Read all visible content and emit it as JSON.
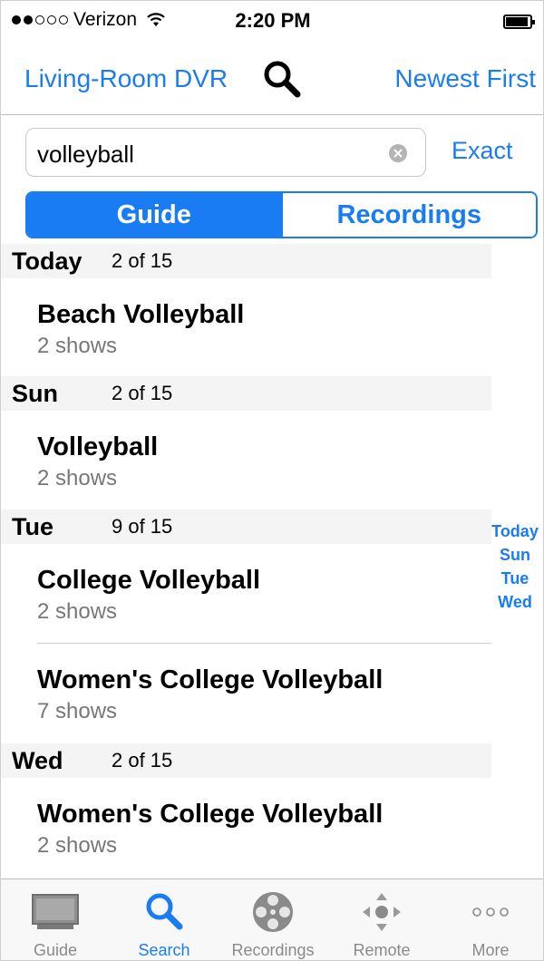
{
  "status_bar": {
    "carrier": "Verizon",
    "time": "2:20 PM",
    "signal_strength": 2,
    "signal_max": 5
  },
  "nav": {
    "title": "Living-Room DVR",
    "sort_label": "Newest First"
  },
  "search": {
    "value": "volleyball",
    "exact_label": "Exact"
  },
  "segments": {
    "guide": "Guide",
    "recordings": "Recordings"
  },
  "sections": [
    {
      "day": "Today",
      "count": "2 of 15",
      "items": [
        {
          "title": "Beach Volleyball",
          "subtitle": "2 shows"
        }
      ]
    },
    {
      "day": "Sun",
      "count": "2 of 15",
      "items": [
        {
          "title": "Volleyball",
          "subtitle": "2 shows"
        }
      ]
    },
    {
      "day": "Tue",
      "count": "9 of 15",
      "items": [
        {
          "title": "College Volleyball",
          "subtitle": "2 shows"
        },
        {
          "title": "Women's College Volleyball",
          "subtitle": "7 shows"
        }
      ]
    },
    {
      "day": "Wed",
      "count": "2 of 15",
      "items": [
        {
          "title": "Women's College Volleyball",
          "subtitle": "2 shows"
        }
      ]
    }
  ],
  "index": [
    "Today",
    "Sun",
    "Tue",
    "Wed"
  ],
  "tabs": [
    {
      "label": "Guide",
      "icon": "tv-icon"
    },
    {
      "label": "Search",
      "icon": "search-icon"
    },
    {
      "label": "Recordings",
      "icon": "film-reel-icon"
    },
    {
      "label": "Remote",
      "icon": "dpad-icon"
    },
    {
      "label": "More",
      "icon": "ellipsis-icon"
    }
  ],
  "colors": {
    "accent": "#1a7cf2",
    "section_bg": "#f4f4f4",
    "secondary_text": "#777777"
  }
}
